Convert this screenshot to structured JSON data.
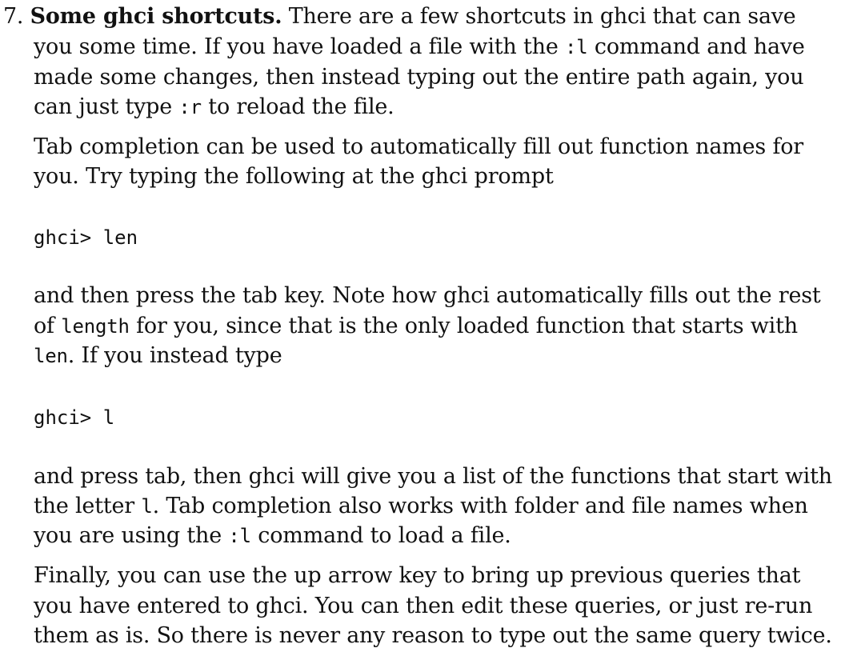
{
  "item": {
    "number": "7.",
    "title": "Some ghci shortcuts."
  },
  "p1": {
    "l1_text": "There are a few shortcuts in ghci that can save",
    "l2": "you some time. If you have loaded a file with the",
    "cmd_load": ":l",
    "l2b": "command and have",
    "l3": "made some changes, then instead typing out the entire path again, you",
    "l4a": "can just type",
    "cmd_reload": ":r",
    "l4b": "to reload the file."
  },
  "p2": {
    "l1": "Tab completion can be used to automatically fill out function names for",
    "l2": "you. Try typing the following at the ghci prompt"
  },
  "code1": "ghci> len",
  "p3": {
    "l1": "and then press the tab key. Note how ghci automatically fills out the rest",
    "l2a": "of",
    "code_length": "length",
    "l2b": "for you, since that is the only loaded function that starts with",
    "code_len": "len",
    "l3b": ". If you instead type"
  },
  "code2": "ghci> l",
  "p4": {
    "l1": "and press tab, then ghci will give you a list of the functions that start with",
    "l2a": "the letter",
    "code_l": "l",
    "l2b": ". Tab completion also works with folder and file names when",
    "l3a": "you are using the",
    "cmd_load": ":l",
    "l3b": "command to load a file."
  },
  "p5": {
    "l1": "Finally, you can use the up arrow key to bring up previous queries that",
    "l2": "you have entered to ghci. You can then edit these queries, or just re-run",
    "l3": "them as is. So there is never any reason to type out the same query twice."
  }
}
